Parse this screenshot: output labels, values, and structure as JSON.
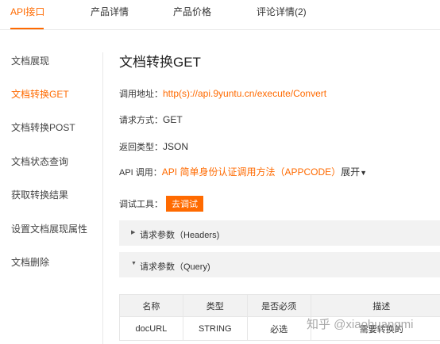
{
  "tabs": [
    {
      "label": "API接口",
      "active": true
    },
    {
      "label": "产品详情",
      "active": false
    },
    {
      "label": "产品价格",
      "active": false
    },
    {
      "label": "评论详情(2)",
      "active": false
    }
  ],
  "sidebar": {
    "items": [
      {
        "label": "文档展现",
        "active": false
      },
      {
        "label": "文档转换GET",
        "active": true
      },
      {
        "label": "文档转换POST",
        "active": false
      },
      {
        "label": "文档状态查询",
        "active": false
      },
      {
        "label": "获取转换结果",
        "active": false
      },
      {
        "label": "设置文档展现属性",
        "active": false
      },
      {
        "label": "文档删除",
        "active": false
      }
    ]
  },
  "main": {
    "title": "文档转换GET",
    "endpoint": {
      "label": "调用地址：",
      "value": "http(s)://api.9yuntu.cn/execute/Convert"
    },
    "method": {
      "label": "请求方式：",
      "value": "GET"
    },
    "return_type": {
      "label": "返回类型：",
      "value": "JSON"
    },
    "api_call": {
      "label": "API 调用：",
      "link": "API 简单身份认证调用方法（APPCODE）",
      "expand": "展开"
    },
    "debug": {
      "label": "调试工具：",
      "button": "去调试"
    },
    "headers_section": {
      "label": "请求参数（Headers)"
    },
    "query_section": {
      "label": "请求参数（Query)"
    },
    "table": {
      "headers": [
        "名称",
        "类型",
        "是否必须",
        "描述"
      ],
      "rows": [
        [
          "docURL",
          "STRING",
          "必选",
          "需要转换的"
        ]
      ]
    }
  },
  "watermark": "知乎 @xiaohuangmi",
  "colors": {
    "accent": "#ff6a00",
    "panel": "#f2f2f2",
    "border": "#e8e8e8"
  }
}
